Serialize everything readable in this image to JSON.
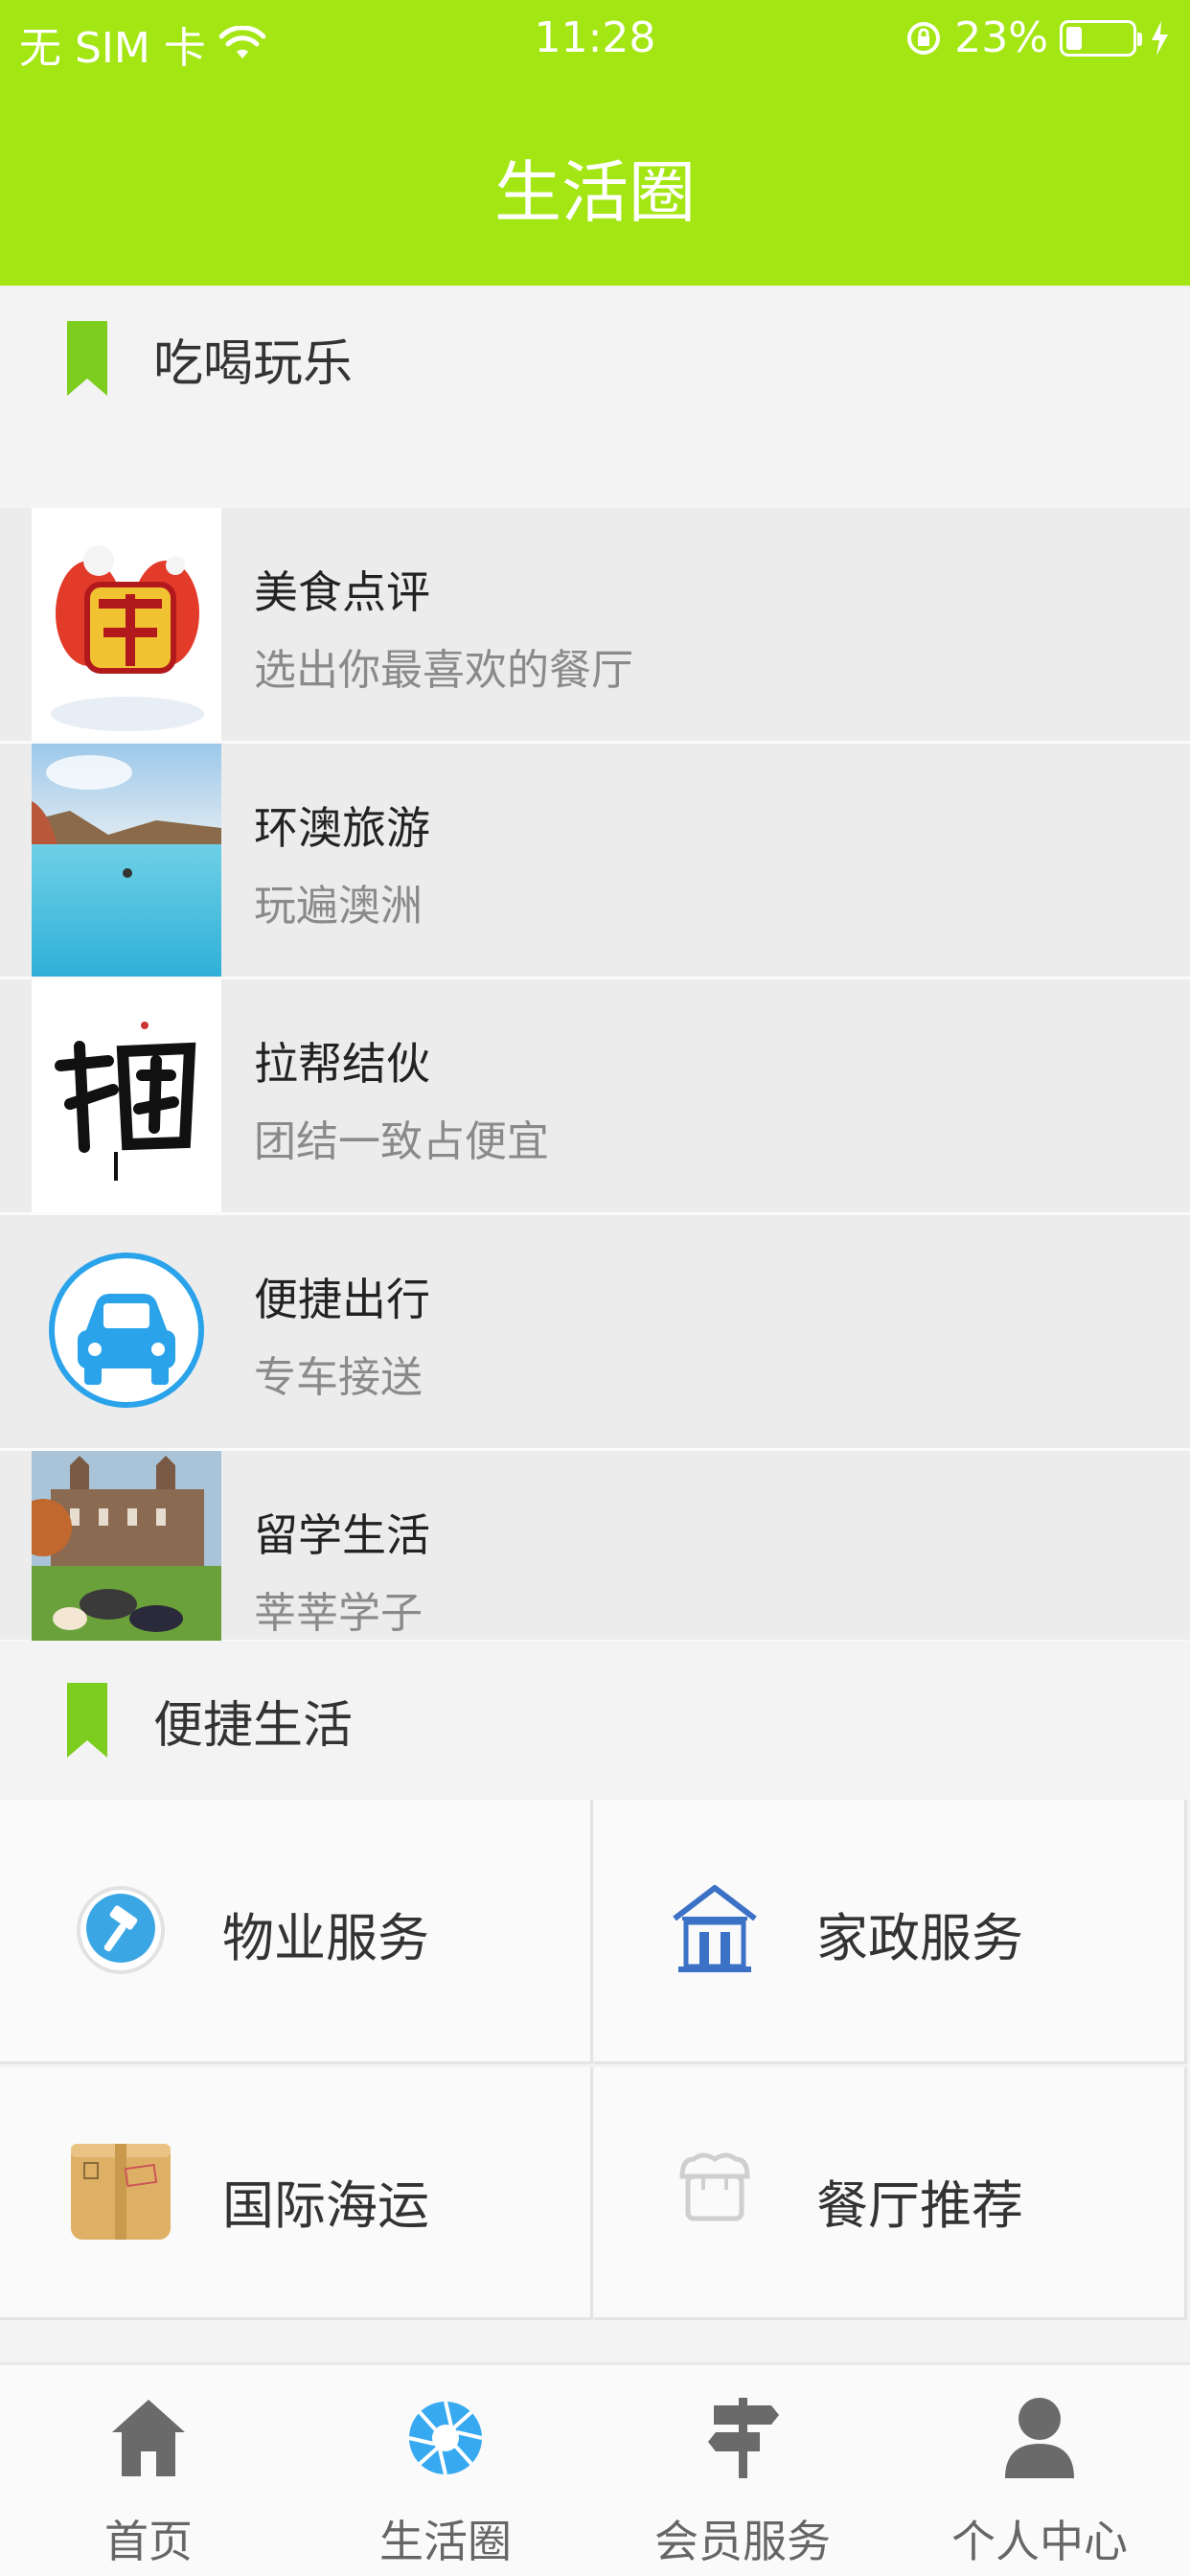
{
  "status_bar": {
    "carrier": "无 SIM 卡",
    "time": "11:28",
    "battery": "23%",
    "battery_level": 0.23
  },
  "nav": {
    "title": "生活圈"
  },
  "sections": {
    "fun": {
      "title": "吃喝玩乐"
    },
    "life": {
      "title": "便捷生活"
    }
  },
  "list_items": [
    {
      "title": "美食点评",
      "subtitle": "选出你最喜欢的餐厅",
      "icon": "food-god-image"
    },
    {
      "title": "环澳旅游",
      "subtitle": "玩遍澳洲",
      "icon": "travel-pool-image"
    },
    {
      "title": "拉帮结伙",
      "subtitle": "团结一致占便宜",
      "icon": "group-buy-calligraphy-image"
    },
    {
      "title": "便捷出行",
      "subtitle": "专车接送",
      "icon": "car-icon"
    },
    {
      "title": "留学生活",
      "subtitle": "莘莘学子",
      "icon": "campus-image"
    }
  ],
  "grid_items": [
    {
      "label": "物业服务",
      "icon": "hammer-icon"
    },
    {
      "label": "家政服务",
      "icon": "house-icon"
    },
    {
      "label": "国际海运",
      "icon": "package-box-icon"
    },
    {
      "label": "餐厅推荐",
      "icon": "restaurant-icon"
    }
  ],
  "tabs": [
    {
      "label": "首页",
      "icon": "home-icon"
    },
    {
      "label": "生活圈",
      "icon": "aperture-icon"
    },
    {
      "label": "会员服务",
      "icon": "signpost-icon"
    },
    {
      "label": "个人中心",
      "icon": "user-icon"
    }
  ],
  "colors": {
    "brand_green": "#a3e614",
    "bookmark_green": "#7ccd1e",
    "active_blue": "#36a9f0"
  }
}
